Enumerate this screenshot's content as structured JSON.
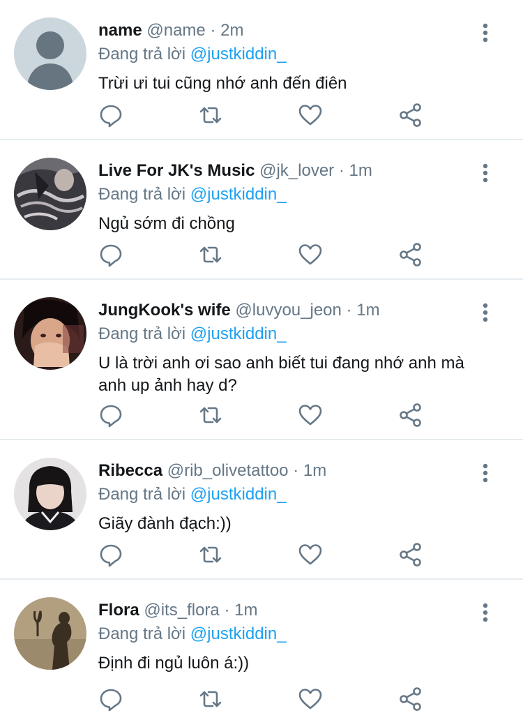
{
  "reply_prefix": "Đang trả lời",
  "tweets": [
    {
      "name": "name",
      "handle": "@name",
      "dot": "·",
      "time": "2m",
      "reply_to": "@justkiddin_",
      "text": "Trừi ưi tui cũng nhớ anh đến điên",
      "avatar": "default-avatar"
    },
    {
      "name": "Live For JK's Music",
      "handle": "@jk_lover",
      "dot": "·",
      "time": "1m",
      "reply_to": "@justkiddin_",
      "text": "Ngủ sớm đi chồng",
      "avatar": "photo-avatar"
    },
    {
      "name": "JungKook's wife",
      "handle": "@luvyou_jeon",
      "dot": "·",
      "time": "1m",
      "reply_to": "@justkiddin_",
      "text": "U là trời anh ơi sao anh biết tui đang nhớ anh mà anh up ảnh hay d?",
      "avatar": "photo-avatar"
    },
    {
      "name": "Ribecca",
      "handle": "@rib_olivetattoo",
      "dot": "·",
      "time": "1m",
      "reply_to": "@justkiddin_",
      "text": "Giãy đành đạch:))",
      "avatar": "photo-avatar"
    },
    {
      "name": "Flora",
      "handle": "@its_flora",
      "dot": "·",
      "time": "1m",
      "reply_to": "@justkiddin_",
      "text": "Định đi ngủ luôn á:))",
      "avatar": "photo-avatar"
    }
  ],
  "colors": {
    "link": "#1da1f2",
    "secondary": "#657786",
    "text": "#14171a",
    "divider": "#e6ecf0"
  },
  "icons": [
    "reply-icon",
    "retweet-icon",
    "like-icon",
    "share-icon",
    "more-options-icon"
  ]
}
